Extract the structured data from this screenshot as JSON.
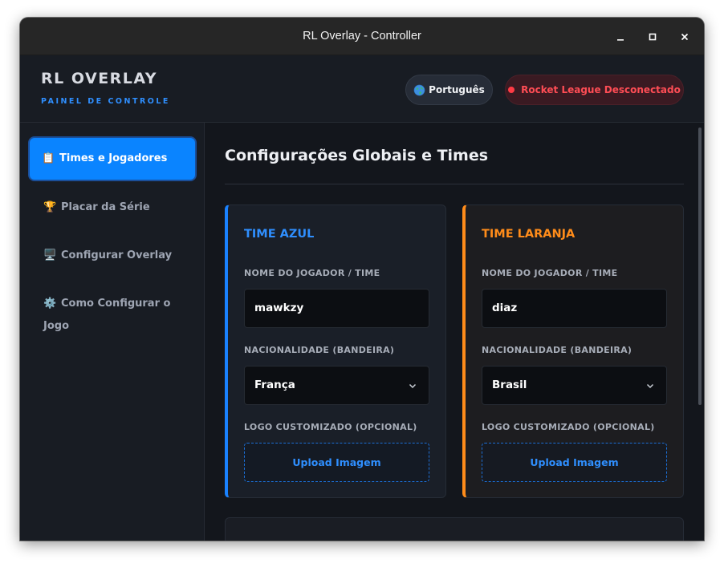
{
  "window": {
    "title": "RL Overlay - Controller"
  },
  "header": {
    "brand": "RL OVERLAY",
    "subtitle": "PAINEL DE CONTROLE",
    "language": {
      "icon": "globe-icon",
      "label": "Português"
    },
    "status": {
      "label": "Rocket League Desconectado",
      "color": "#ff4d55"
    }
  },
  "sidebar": {
    "items": [
      {
        "emoji": "📋",
        "label": "Times e Jogadores",
        "active": true
      },
      {
        "emoji": "🏆",
        "label": "Placar da Série",
        "active": false
      },
      {
        "emoji": "🖥️",
        "label": "Configurar Overlay",
        "active": false
      },
      {
        "emoji": "⚙️",
        "label_line1": "Como Configurar o",
        "label_line2": "Jogo",
        "active": false
      }
    ]
  },
  "main": {
    "title": "Configurações Globais e Times",
    "teams": {
      "blue": {
        "title": "TIME AZUL",
        "accent": "#1a82ff",
        "name_label": "NOME DO JOGADOR / TIME",
        "name_value": "mawkzy",
        "nationality_label": "NACIONALIDADE (BANDEIRA)",
        "nationality_value": "França",
        "logo_label": "LOGO CUSTOMIZADO (OPCIONAL)",
        "upload_label": "Upload Imagem"
      },
      "orange": {
        "title": "TIME LARANJA",
        "accent": "#ff8c1a",
        "name_label": "NOME DO JOGADOR / TIME",
        "name_value": "diaz",
        "nationality_label": "NACIONALIDADE (BANDEIRA)",
        "nationality_value": "Brasil",
        "logo_label": "LOGO CUSTOMIZADO (OPCIONAL)",
        "upload_label": "Upload Imagem"
      }
    }
  }
}
